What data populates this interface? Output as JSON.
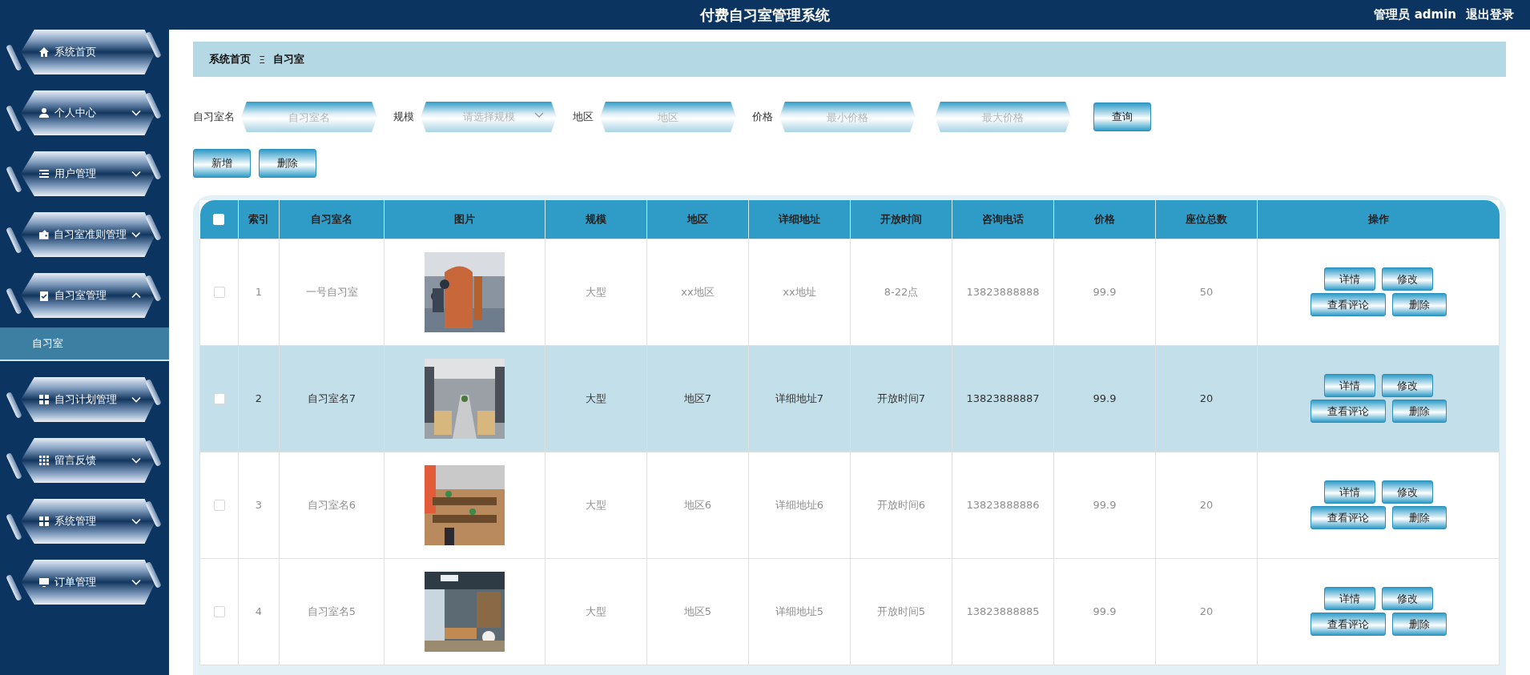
{
  "header": {
    "title": "付费自习室管理系统",
    "user": "管理员 admin",
    "logout": "退出登录"
  },
  "sidebar": {
    "items": [
      {
        "label": "系统首页",
        "kind": "link"
      },
      {
        "label": "个人中心",
        "kind": "group",
        "expanded": false
      },
      {
        "label": "用户管理",
        "kind": "group",
        "expanded": false
      },
      {
        "label": "自习室准则管理",
        "kind": "group",
        "expanded": false
      },
      {
        "label": "自习室管理",
        "kind": "group",
        "expanded": true,
        "children": [
          {
            "label": "自习室",
            "selected": true
          }
        ]
      },
      {
        "label": "自习计划管理",
        "kind": "group",
        "expanded": false
      },
      {
        "label": "留言反馈",
        "kind": "group",
        "expanded": false
      },
      {
        "label": "系统管理",
        "kind": "group",
        "expanded": false
      },
      {
        "label": "订单管理",
        "kind": "group",
        "expanded": false
      }
    ]
  },
  "breadcrumb": {
    "items": [
      "系统首页",
      "自习室"
    ],
    "separator": "Ξ"
  },
  "filters": [
    {
      "label": "自习室名",
      "kind": "input",
      "placeholder": "自习室名"
    },
    {
      "label": "规模",
      "kind": "select",
      "placeholder": "请选择规模"
    },
    {
      "label": "地区",
      "kind": "input",
      "placeholder": "地区"
    },
    {
      "label": "价格",
      "kind": "range",
      "placeholder": "最小价格",
      "placeholder_max": "最大价格"
    }
  ],
  "search_button": "查询",
  "actions": [
    "新增",
    "删除"
  ],
  "table": {
    "header_checked": false,
    "columns": [
      "索引",
      "自习室名",
      "图片",
      "规模",
      "地区",
      "详细地址",
      "开放时间",
      "咨询电话",
      "价格",
      "座位总数",
      "操作"
    ],
    "rows": [
      {
        "checked": false,
        "highlighted": false,
        "cells": [
          "1",
          "一号自习室",
          "",
          "大型",
          "xx地区",
          "xx地址",
          "8-22点",
          "13823888888",
          "99.9",
          "50"
        ],
        "buttons": [
          "详情",
          "修改",
          "查看评论",
          "删除"
        ]
      },
      {
        "checked": false,
        "highlighted": true,
        "cells": [
          "2",
          "自习室名7",
          "",
          "大型",
          "地区7",
          "详细地址7",
          "开放时间7",
          "13823888887",
          "99.9",
          "20"
        ],
        "buttons": [
          "详情",
          "修改",
          "查看评论",
          "删除"
        ]
      },
      {
        "checked": false,
        "highlighted": false,
        "cells": [
          "3",
          "自习室名6",
          "",
          "大型",
          "地区6",
          "详细地址6",
          "开放时间6",
          "13823888886",
          "99.9",
          "20"
        ],
        "buttons": [
          "详情",
          "修改",
          "查看评论",
          "删除"
        ]
      },
      {
        "checked": false,
        "highlighted": false,
        "cells": [
          "4",
          "自习室名5",
          "",
          "大型",
          "地区5",
          "详细地址5",
          "开放时间5",
          "13823888885",
          "99.9",
          "20"
        ],
        "buttons": [
          "详情",
          "修改",
          "查看评论",
          "删除"
        ]
      }
    ]
  }
}
